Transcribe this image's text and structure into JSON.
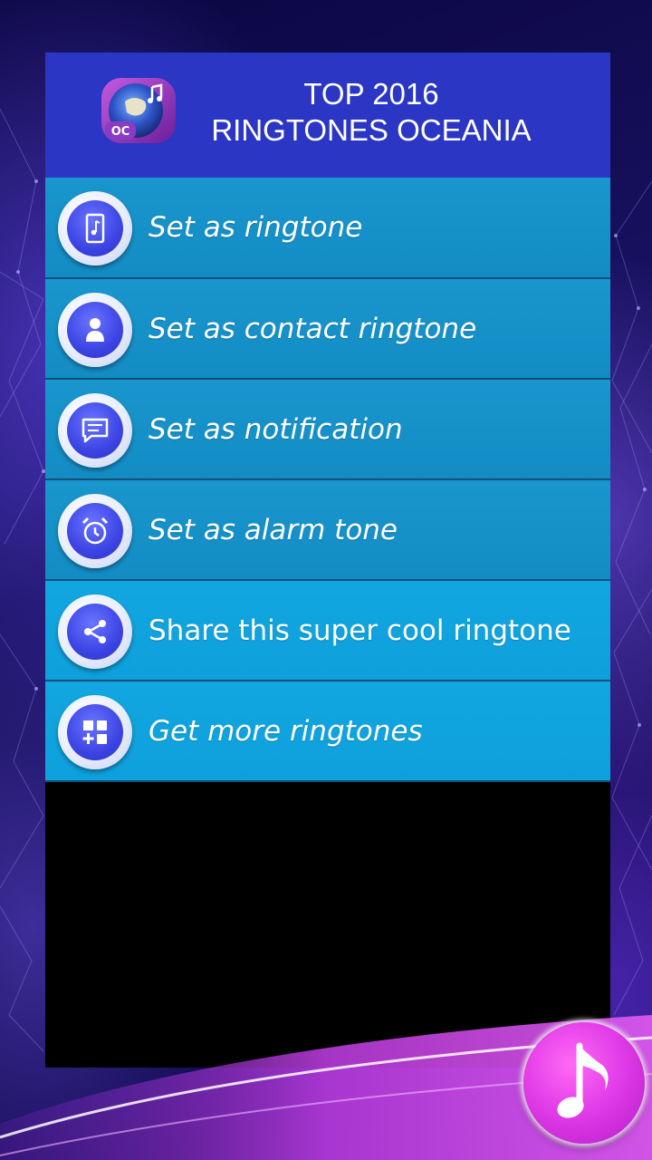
{
  "header": {
    "title_line1": "TOP 2016",
    "title_line2": "RINGTONES OCEANIA",
    "logo_text": "OC"
  },
  "menu": {
    "items": [
      {
        "label": "Set as ringtone",
        "icon": "phone-music-icon"
      },
      {
        "label": "Set as contact ringtone",
        "icon": "contact-icon"
      },
      {
        "label": "Set as notification",
        "icon": "message-icon"
      },
      {
        "label": "Set as alarm tone",
        "icon": "alarm-clock-icon"
      },
      {
        "label": "Share this super cool ringtone",
        "icon": "share-icon"
      },
      {
        "label": "Get more ringtones",
        "icon": "apps-add-icon"
      }
    ]
  },
  "fab": {
    "icon": "music-note-icon"
  },
  "colors": {
    "header": "#2b36c4",
    "menu_item": "#138cc4",
    "menu_item_highlight": "#0ea0dc",
    "icon_circle": "#3c44e4",
    "fab": "#e23de8"
  }
}
